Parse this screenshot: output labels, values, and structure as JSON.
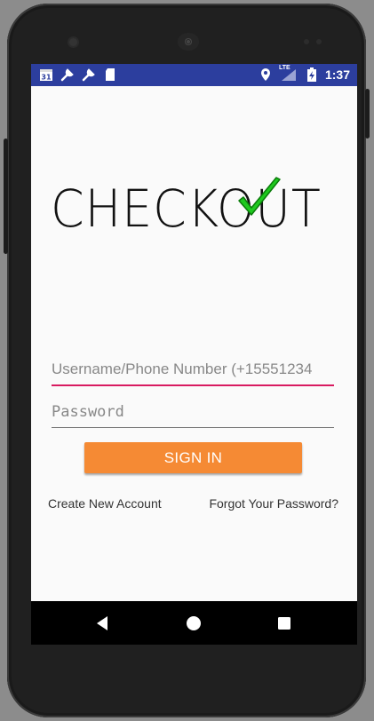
{
  "statusbar": {
    "left_icons": [
      "calendar-icon",
      "wrench-icon",
      "wrench-icon",
      "sd-card-icon"
    ],
    "calendar_day": "31",
    "network_label": "LTE",
    "time": "1:37"
  },
  "logo": {
    "text": "CHECKOUT",
    "check_color": "#22dd22"
  },
  "login": {
    "username_placeholder": "Username/Phone Number (+15551234",
    "password_placeholder": "Password",
    "signin_label": "SIGN IN",
    "create_account_label": "Create New Account",
    "forgot_password_label": "Forgot Your Password?"
  },
  "navbar": {
    "items": [
      "back-icon",
      "home-icon",
      "recents-icon"
    ]
  },
  "colors": {
    "statusbar": "#2c3e9e",
    "accent": "#d81b60",
    "button": "#f58a34"
  }
}
